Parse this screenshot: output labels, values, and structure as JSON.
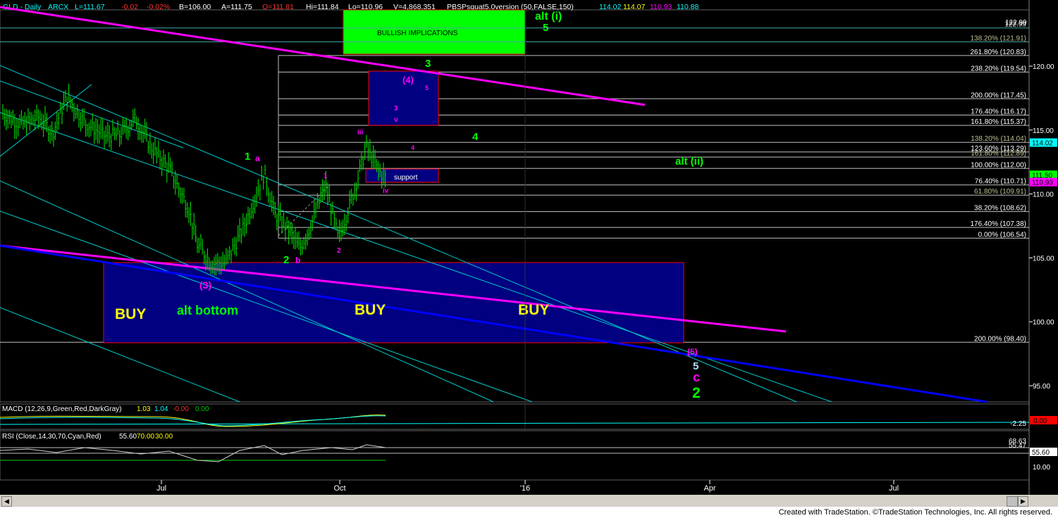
{
  "header": {
    "symbol": "GLD - Daily",
    "exchange": "ARCX",
    "stats": [
      {
        "text": "L=111.67",
        "color": "#00ffff"
      },
      {
        "text": "-0.02",
        "color": "#ff3030"
      },
      {
        "text": "-0.02%",
        "color": "#ff3030"
      },
      {
        "text": "B=106.00",
        "color": "#ffffff"
      },
      {
        "text": "A=111.75",
        "color": "#ffffff"
      },
      {
        "text": "O=111.81",
        "color": "#ff3030"
      },
      {
        "text": "Hi=111.84",
        "color": "#ffffff"
      },
      {
        "text": "Lo=110.96",
        "color": "#ffffff"
      },
      {
        "text": "V=4,868,351",
        "color": "#ffffff"
      },
      {
        "text": "PBSPsquat5.0version (50,FALSE,150)",
        "color": "#ffffff"
      },
      {
        "text": "114.02",
        "color": "#00ffff"
      },
      {
        "text": "114.07",
        "color": "#ffff00"
      },
      {
        "text": "110.93",
        "color": "#ff00ff"
      },
      {
        "text": "110.88",
        "color": "#00ffff"
      }
    ]
  },
  "colors": {
    "background": "#000000",
    "bars": "#00cc00",
    "channel": "#00cccc",
    "trend_magenta": "#ff00ff",
    "trend_blue": "#0000ff",
    "box_blue": "#000080",
    "box_green": "#00ff00",
    "fib_lines": "#c0c0c0",
    "buy_text": "#ffff00",
    "wave_green": "#00ff00",
    "wave_magenta": "#ff00ff"
  },
  "chart_data": {
    "type": "candlestick",
    "symbol": "GLD",
    "interval": "Daily",
    "ylim": [
      92.5,
      123.8
    ],
    "y_ticks": [
      "122.99",
      "120.00",
      "115.00",
      "110.00",
      "105.00",
      "100.00",
      "95.00"
    ],
    "x_ticks": [
      "Jul",
      "Oct",
      "'16",
      "Apr",
      "Jul"
    ],
    "price_path": [
      {
        "x": 5,
        "y": 116.3
      },
      {
        "x": 30,
        "y": 115.4
      },
      {
        "x": 55,
        "y": 116.0
      },
      {
        "x": 75,
        "y": 114.8
      },
      {
        "x": 95,
        "y": 117.6
      },
      {
        "x": 120,
        "y": 115.6
      },
      {
        "x": 150,
        "y": 114.5
      },
      {
        "x": 170,
        "y": 114.6
      },
      {
        "x": 192,
        "y": 115.9
      },
      {
        "x": 215,
        "y": 113.6
      },
      {
        "x": 240,
        "y": 112.0
      },
      {
        "x": 268,
        "y": 108.8
      },
      {
        "x": 280,
        "y": 106.0
      },
      {
        "x": 300,
        "y": 104.6
      },
      {
        "x": 320,
        "y": 104.6
      },
      {
        "x": 345,
        "y": 107.3
      },
      {
        "x": 375,
        "y": 111.6
      },
      {
        "x": 390,
        "y": 108.4
      },
      {
        "x": 410,
        "y": 107.2
      },
      {
        "x": 425,
        "y": 105.7
      },
      {
        "x": 440,
        "y": 107.4
      },
      {
        "x": 462,
        "y": 110.7
      },
      {
        "x": 480,
        "y": 106.5
      },
      {
        "x": 500,
        "y": 109.8
      },
      {
        "x": 520,
        "y": 113.7
      },
      {
        "x": 535,
        "y": 112.0
      },
      {
        "x": 547,
        "y": 111.2
      }
    ],
    "fib_levels": [
      {
        "label": "122.99",
        "value": 122.99
      },
      {
        "label": "138.20% (121.91)",
        "value": 121.91
      },
      {
        "label": "261.80% (120.83)",
        "value": 120.83
      },
      {
        "label": "238.20% (119.54)",
        "value": 119.54
      },
      {
        "label": "200.00% (117.45)",
        "value": 117.45
      },
      {
        "label": "176.40% (116.17)",
        "value": 116.17
      },
      {
        "label": "161.80% (115.37)",
        "value": 115.37
      },
      {
        "label": "138.20% (114.04)",
        "value": 114.04
      },
      {
        "label": "123.60% (113.29)",
        "value": 113.29
      },
      {
        "label": "161.80% (112.89)",
        "value": 112.89
      },
      {
        "label": "100.00% (112.00)",
        "value": 112.0
      },
      {
        "label": "76.40% (110.71)",
        "value": 110.71
      },
      {
        "label": "61.80% (109.91)",
        "value": 109.91
      },
      {
        "label": "38.20% (108.62)",
        "value": 108.62
      },
      {
        "label": "176.40% (107.38)",
        "value": 107.38
      },
      {
        "label": "0.00% (106.54)",
        "value": 106.54
      },
      {
        "label": "200.00% (98.40)",
        "value": 98.4
      }
    ],
    "price_tags": [
      {
        "label": "114.02",
        "value": 114.02,
        "bg": "#00ffff"
      },
      {
        "label": "111.50",
        "value": 111.5,
        "bg": "#00ff00"
      },
      {
        "label": "110.93",
        "value": 110.93,
        "bg": "#ff00ff"
      }
    ],
    "boxes": [
      {
        "label": "BULLISH IMPLICATIONS"
      },
      {
        "label": "support"
      }
    ],
    "buy_labels": [
      "BUY",
      "BUY",
      "BUY"
    ],
    "alt_bottom": "alt bottom",
    "wave_labels": [
      {
        "text": "alt (i)",
        "color": "#00ff00"
      },
      {
        "text": "5",
        "color": "#00ff00"
      },
      {
        "text": "3",
        "color": "#00ff00"
      },
      {
        "text": "(4)",
        "color": "#ff00ff"
      },
      {
        "text": "5",
        "color": "#ff00ff"
      },
      {
        "text": "3",
        "color": "#ff00ff"
      },
      {
        "text": "v",
        "color": "#ff00ff"
      },
      {
        "text": "iii",
        "color": "#ff00ff"
      },
      {
        "text": "4",
        "color": "#ff00ff"
      },
      {
        "text": "4",
        "color": "#00ff00"
      },
      {
        "text": "alt (ii)",
        "color": "#00ff00"
      },
      {
        "text": "1",
        "color": "#00ff00"
      },
      {
        "text": "a",
        "color": "#ff00ff"
      },
      {
        "text": "1",
        "color": "#ff00ff"
      },
      {
        "text": "iv",
        "color": "#ff00ff"
      },
      {
        "text": "2",
        "color": "#ff00ff"
      },
      {
        "text": "2",
        "color": "#00ff00"
      },
      {
        "text": "b",
        "color": "#ff00ff"
      },
      {
        "text": "(3)",
        "color": "#ff00ff"
      },
      {
        "text": "(5)",
        "color": "#ff00ff"
      },
      {
        "text": "5",
        "color": "#b0e0ff"
      },
      {
        "text": "c",
        "color": "#ff00ff"
      },
      {
        "text": "2",
        "color": "#00ff00"
      }
    ],
    "macd": {
      "label": "MACD (12,26,9,Green,Red,DarkGray)",
      "values": [
        {
          "text": "1.03",
          "color": "#ffff00"
        },
        {
          "text": "1.04",
          "color": "#00ffff"
        },
        {
          "text": "-0.00",
          "color": "#ff3030"
        },
        {
          "text": "0.00",
          "color": "#00cc00"
        }
      ],
      "tick": "-2.25",
      "tag": "0.00"
    },
    "rsi": {
      "label": "RSI (Close,14,30,70,Cyan,Red)",
      "values": [
        {
          "text": "55.60",
          "color": "#ffffff"
        },
        {
          "text": "70.00",
          "color": "#ffff00"
        },
        {
          "text": "30.00",
          "color": "#ffff00"
        }
      ],
      "ticks": [
        "68.63",
        "55.47",
        "10.00"
      ],
      "tag": "55.60"
    }
  },
  "footer": "Created with TradeStation. ©TradeStation Technologies, Inc. All rights reserved."
}
